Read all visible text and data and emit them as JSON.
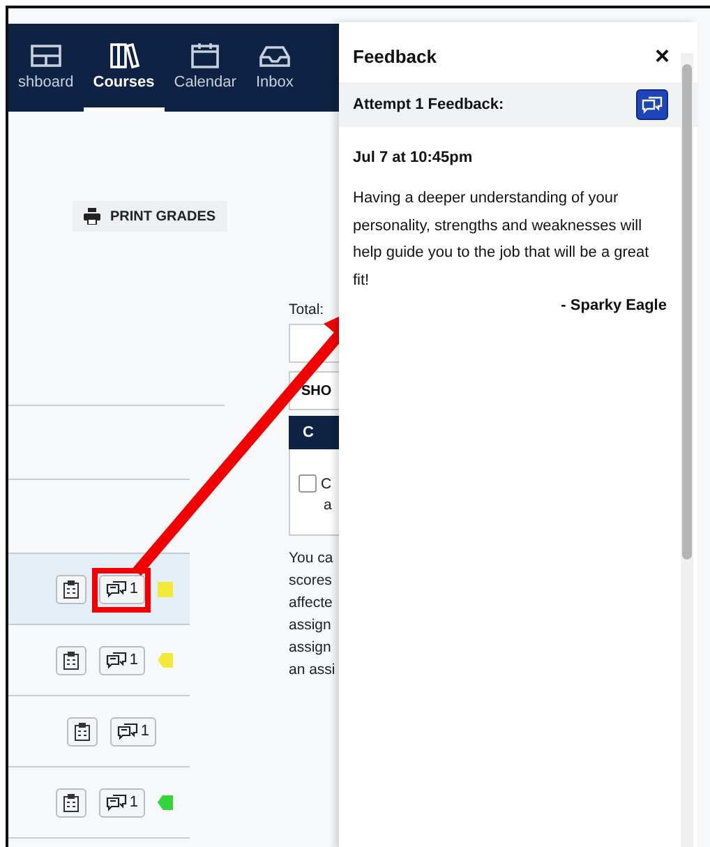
{
  "nav": [
    {
      "label": "shboard",
      "selected": false
    },
    {
      "label": "Courses",
      "selected": true
    },
    {
      "label": "Calendar",
      "selected": false
    },
    {
      "label": "Inbox",
      "selected": false
    }
  ],
  "print_button": "PRINT GRADES",
  "side_column": {
    "total": "Total:",
    "show_button": "SHO",
    "header": "C",
    "checkbox": {
      "label_lines": [
        "C",
        "a"
      ],
      "checked": false
    },
    "note_lines": [
      "You ca",
      "scores",
      "affecte",
      "assign",
      "assign",
      "an assi"
    ]
  },
  "rows": [
    {
      "selected": true,
      "comments": "1",
      "color": "#f2ea3a",
      "kind": "square"
    },
    {
      "selected": false,
      "comments": "1",
      "color": "#f2ea3a",
      "kind": "tag"
    },
    {
      "selected": false,
      "comments": "1",
      "kind": "plain"
    },
    {
      "selected": false,
      "comments": "1",
      "color": "#33d63a",
      "kind": "tag"
    }
  ],
  "drawer": {
    "title": "Feedback",
    "close": "×",
    "section": "Attempt 1 Feedback:",
    "date": "Jul 7 at 10:45pm",
    "message": "Having a deeper understanding of your personality, strengths and weaknesses will help guide you to the job that will be a great fit!",
    "author": "- Sparky Eagle"
  }
}
